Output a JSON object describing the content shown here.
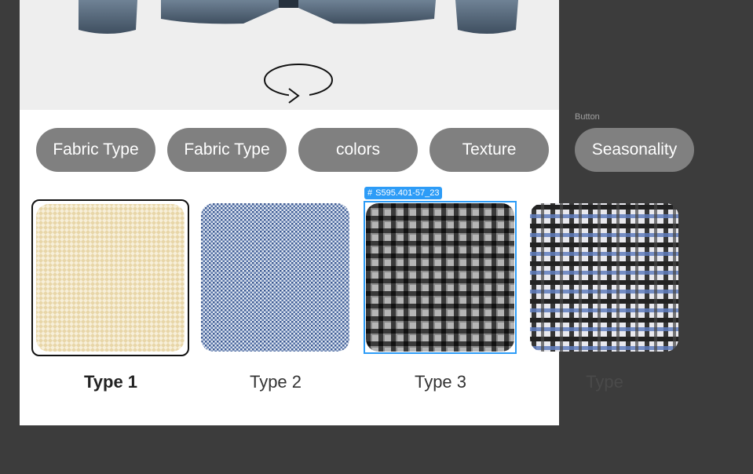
{
  "chips": [
    {
      "label": "Fabric Type"
    },
    {
      "label": "Fabric Type"
    },
    {
      "label": "colors"
    },
    {
      "label": "Texture"
    },
    {
      "label": "Seasonality"
    }
  ],
  "hint": {
    "label": "Button"
  },
  "selection_tag": {
    "text": "S595.401-57_23"
  },
  "swatches": [
    {
      "label": "Type 1",
      "icon": "cream-houndstooth-fabric"
    },
    {
      "label": "Type 2",
      "icon": "blue-houndstooth-fabric"
    },
    {
      "label": "Type 3",
      "icon": "black-grey-check-fabric"
    },
    {
      "label": "Type",
      "icon": "black-blue-plaid-fabric"
    }
  ],
  "colors": {
    "canvas": "#3c3c3c",
    "chip": "#808080",
    "selection": "#2d9cf7"
  }
}
